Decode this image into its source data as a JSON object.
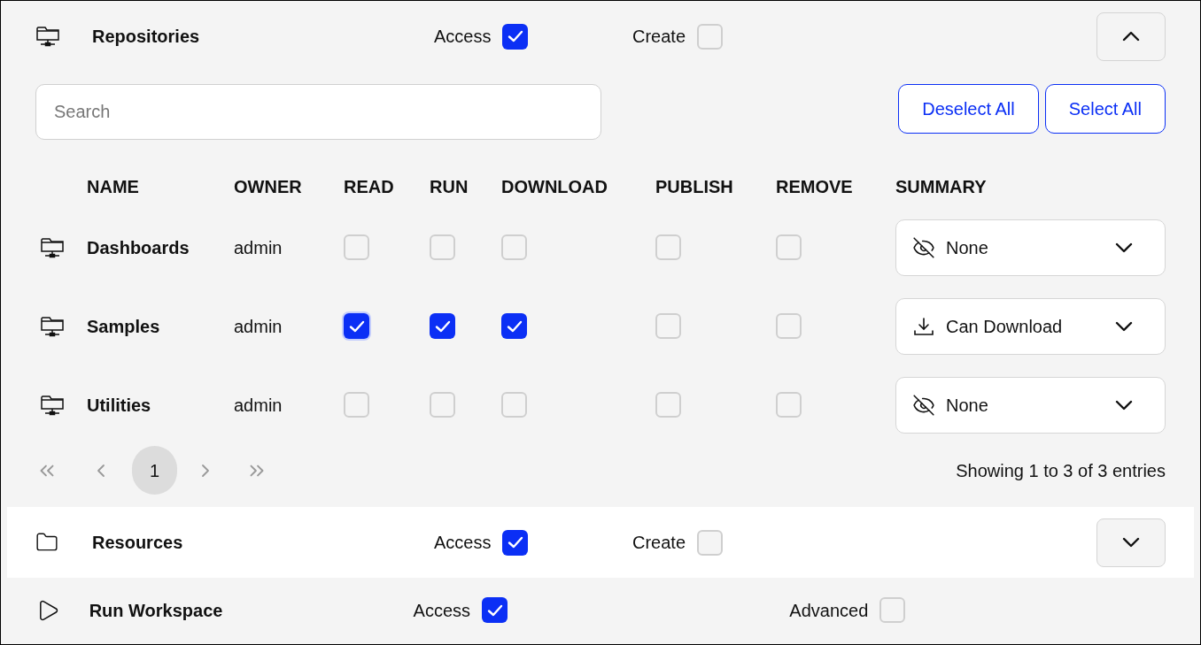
{
  "sections": [
    {
      "kind": "table_section",
      "title": "Repositories",
      "highlighted": false,
      "expanded": true,
      "options": [
        {
          "label": "Access",
          "checked": true
        },
        {
          "label": "Create",
          "checked": false
        }
      ],
      "search": {
        "placeholder": "Search"
      },
      "buttons": [
        "Deselect All",
        "Select All"
      ],
      "table": {
        "columns": [
          "NAME",
          "OWNER",
          "READ",
          "RUN",
          "DOWNLOAD",
          "PUBLISH",
          "REMOVE",
          "SUMMARY"
        ],
        "rows": [
          {
            "name": "Dashboards",
            "owner": "admin",
            "permissions": [
              {
                "checked": false,
                "focused": false
              },
              {
                "checked": false,
                "focused": false
              },
              {
                "checked": false,
                "focused": false
              },
              {
                "checked": false,
                "focused": false
              },
              {
                "checked": false,
                "focused": false
              }
            ],
            "summary": {
              "kind": "hidden",
              "value": "None"
            }
          },
          {
            "name": "Samples",
            "owner": "admin",
            "permissions": [
              {
                "checked": true,
                "focused": true
              },
              {
                "checked": true,
                "focused": false
              },
              {
                "checked": true,
                "focused": false
              },
              {
                "checked": false,
                "focused": false
              },
              {
                "checked": false,
                "focused": false
              }
            ],
            "summary": {
              "kind": "download",
              "value": "Can Download"
            }
          },
          {
            "name": "Utilities",
            "owner": "admin",
            "permissions": [
              {
                "checked": false,
                "focused": false
              },
              {
                "checked": false,
                "focused": false
              },
              {
                "checked": false,
                "focused": false
              },
              {
                "checked": false,
                "focused": false
              },
              {
                "checked": false,
                "focused": false
              }
            ],
            "summary": {
              "kind": "hidden",
              "value": "None"
            }
          }
        ]
      },
      "pagination": {
        "pages": [
          {
            "label": "1",
            "selected": true
          }
        ],
        "summary": "Showing 1 to 3 of 3 entries"
      }
    },
    {
      "kind": "table_section",
      "title": "Resources",
      "highlighted": true,
      "expanded": false,
      "options": [
        {
          "label": "Access",
          "checked": true
        },
        {
          "label": "Create",
          "checked": false
        }
      ]
    },
    {
      "kind": "plain",
      "title": "Run Workspace",
      "highlighted": false,
      "options": [
        {
          "label": "Access",
          "checked": true
        },
        {
          "label": "Advanced",
          "checked": false
        }
      ]
    }
  ]
}
